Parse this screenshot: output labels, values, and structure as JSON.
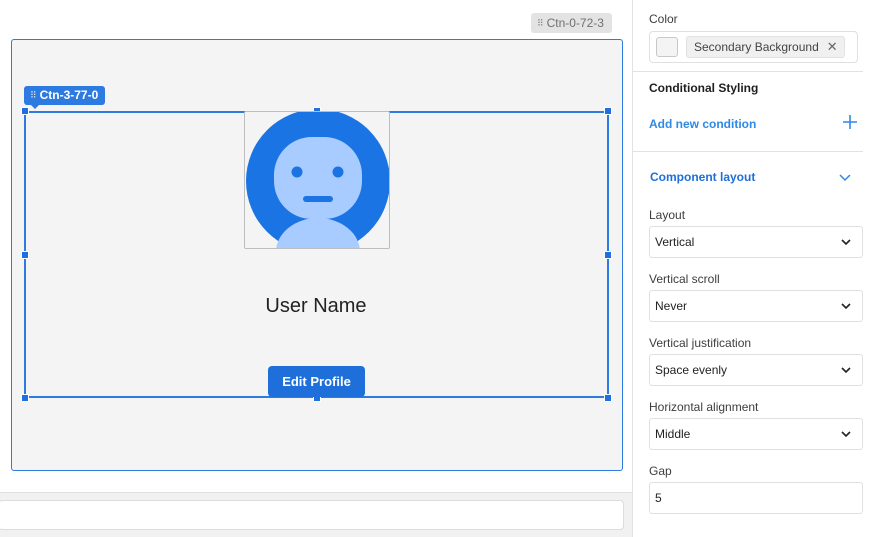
{
  "canvas": {
    "outer_container_tag": "Ctn-0-72-3",
    "inner_container_tag": "Ctn-3-77-0",
    "user_name": "User Name",
    "edit_button_label": "Edit Profile",
    "avatar_icon": "user-avatar-icon"
  },
  "panel": {
    "color_label": "Color",
    "color_value": "Secondary Background",
    "conditional_styling_title": "Conditional Styling",
    "add_condition_label": "Add new condition",
    "component_layout_title": "Component layout",
    "layout_label": "Layout",
    "layout_value": "Vertical",
    "vertical_scroll_label": "Vertical scroll",
    "vertical_scroll_value": "Never",
    "vertical_justification_label": "Vertical justification",
    "vertical_justification_value": "Space evenly",
    "horizontal_alignment_label": "Horizontal alignment",
    "horizontal_alignment_value": "Middle",
    "gap_label": "Gap",
    "gap_value": "5"
  },
  "colors": {
    "selection_blue": "#2d7be0",
    "button_blue": "#1e6fd9",
    "avatar_dark": "#1b74e4",
    "avatar_light": "#a8ccff",
    "link_blue": "#2d8ae6"
  }
}
